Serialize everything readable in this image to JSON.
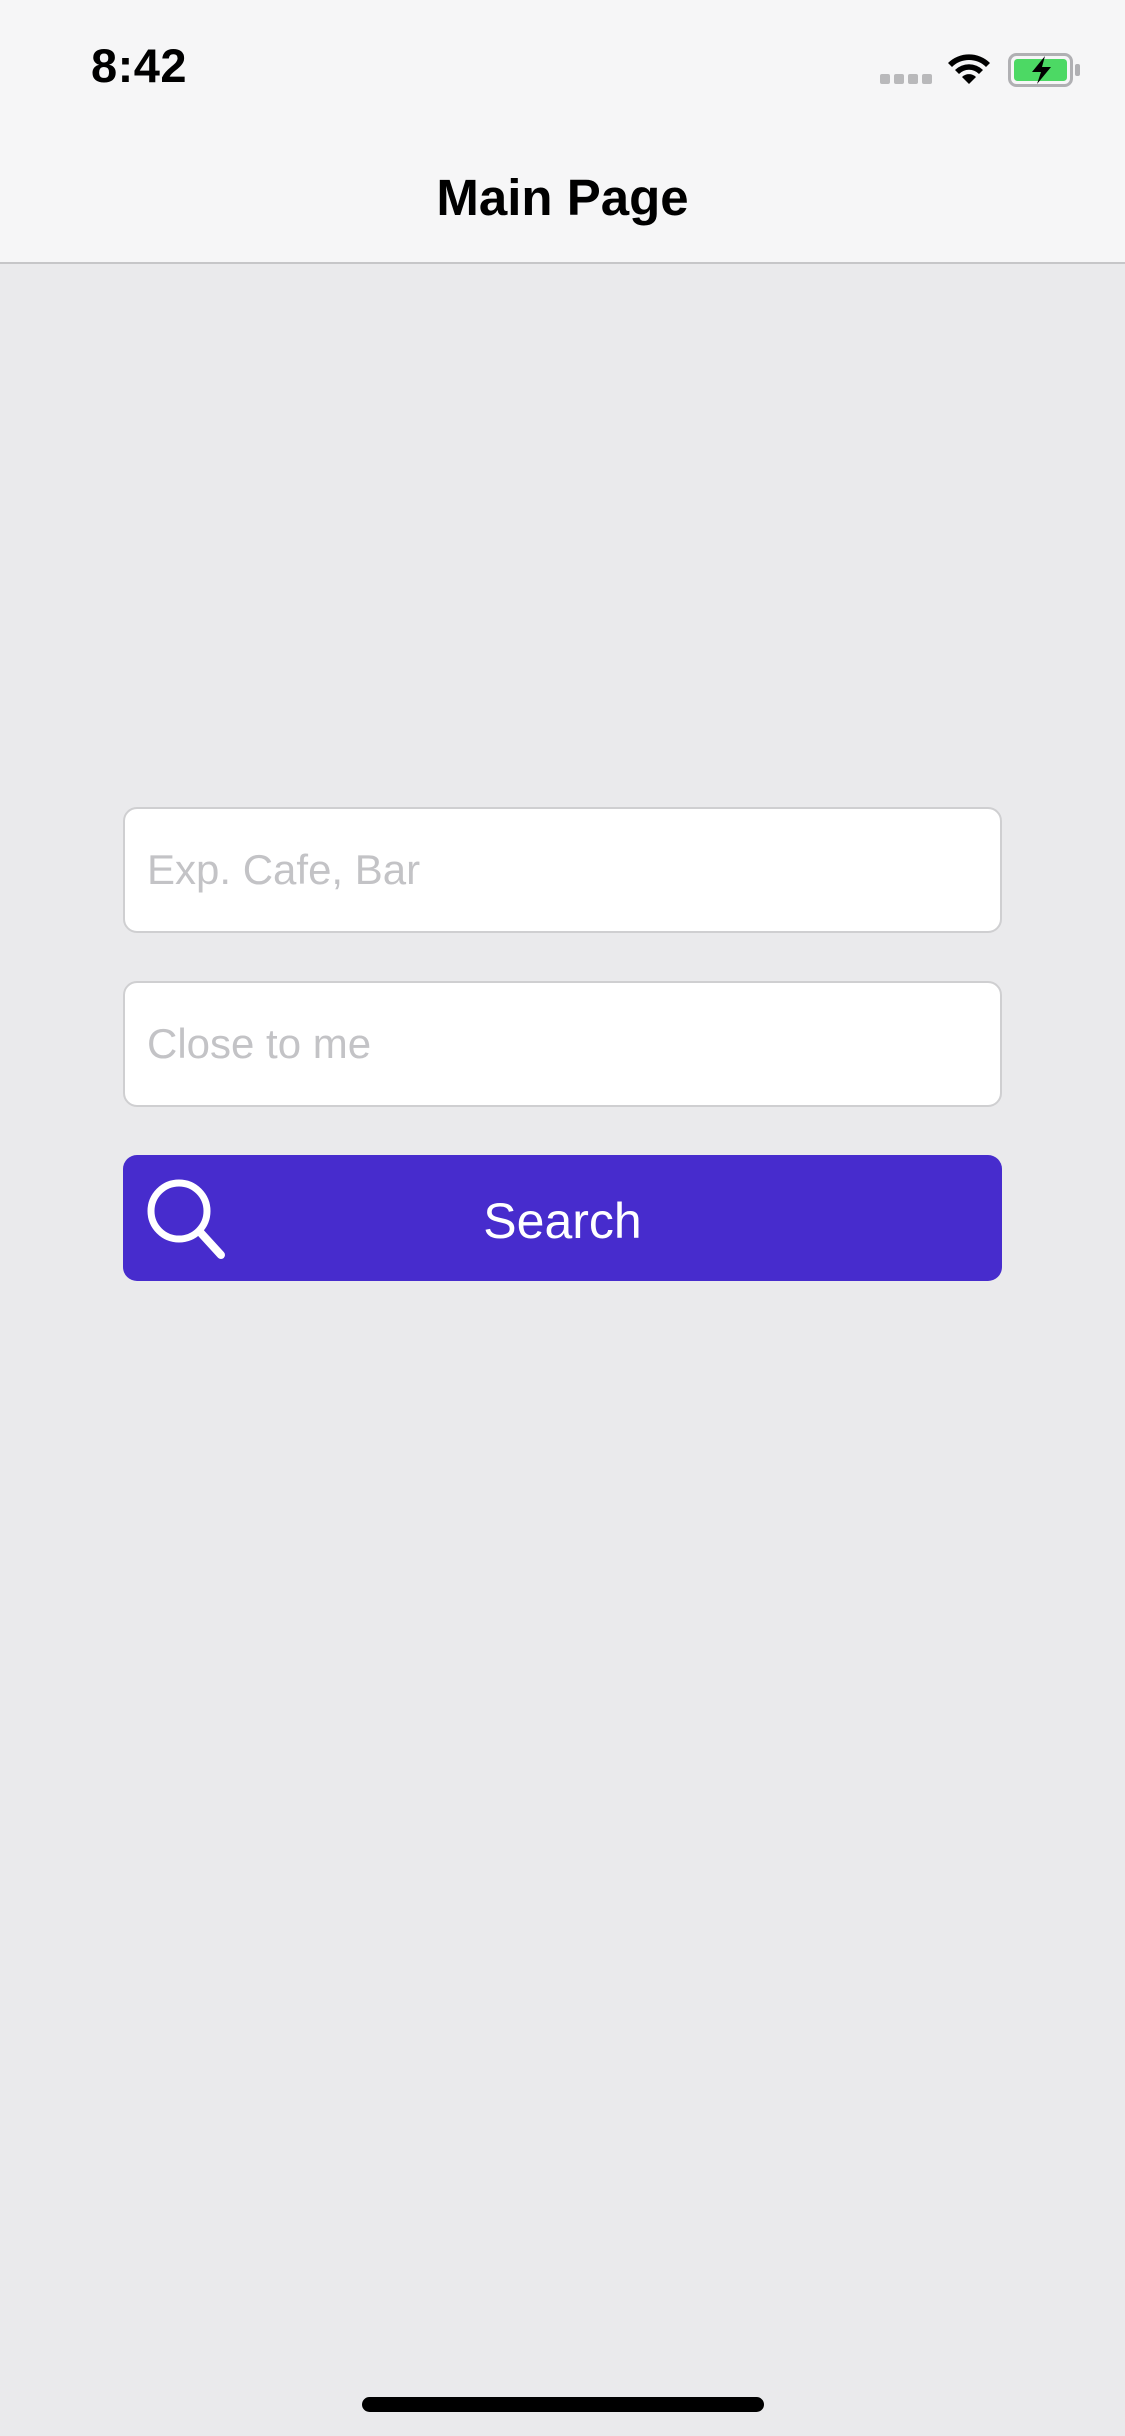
{
  "status_bar": {
    "time": "8:42",
    "icons": [
      "signal-dots-icon",
      "wifi-icon",
      "battery-charging-icon"
    ],
    "battery_color": "#4cd964"
  },
  "nav": {
    "title": "Main Page"
  },
  "form": {
    "what_field": {
      "placeholder": "Exp. Cafe, Bar",
      "value": ""
    },
    "where_field": {
      "placeholder": "Close to me",
      "value": ""
    },
    "search_button": {
      "label": "Search",
      "icon": "search-icon",
      "color": "#472ccd"
    }
  }
}
